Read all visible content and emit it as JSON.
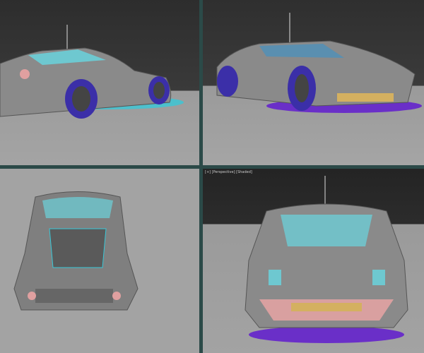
{
  "viewports": [
    {
      "name": "top-left",
      "label": ""
    },
    {
      "name": "top-right",
      "label": ""
    },
    {
      "name": "bottom-left",
      "label": ""
    },
    {
      "name": "bottom-right",
      "label": "[+] [Perspective] [Shaded]"
    }
  ],
  "colors": {
    "divider": "#2b4a48",
    "body": "#8a8a8a",
    "wheel": "#3b2fa8",
    "accent": "#38c8d8",
    "trim": "#d9a0a0"
  }
}
